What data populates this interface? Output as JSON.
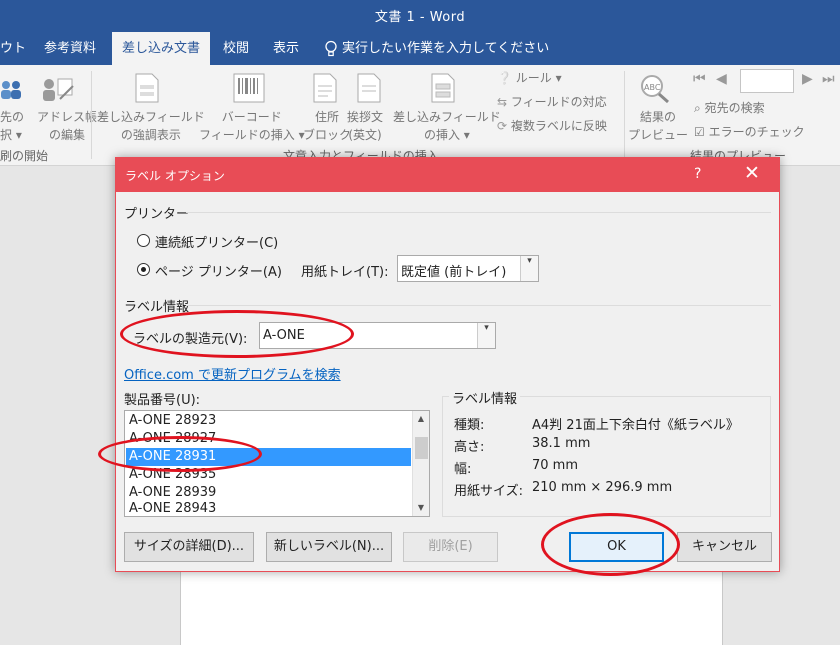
{
  "window": {
    "title": "文書 1  -  Word"
  },
  "menu_tabs": {
    "layout_partial": "ウト",
    "references": "参考資料",
    "mailings": "差し込み文書",
    "review": "校閲",
    "view": "表示",
    "tell_me": "実行したい作業を入力してください"
  },
  "ribbon": {
    "select_recipients_1": "先の",
    "select_recipients_2": "択 ▾",
    "edit_recipients_1": "アドレス帳",
    "edit_recipients_2": "の編集",
    "group_start": "刷の開始",
    "highlight_1": "差し込みフィールド",
    "highlight_2": "の強調表示",
    "barcode_1": "バーコード",
    "barcode_2": "フィールドの挿入 ▾",
    "address_1": "住所",
    "address_2": "ブロック",
    "greeting_1": "挨拶文",
    "greeting_2": "(英文)",
    "insert_merge_1": "差し込みフィールド",
    "insert_merge_2": "の挿入 ▾",
    "rules": "ルール ▾",
    "match_fields": "フィールドの対応",
    "update_labels": "複数ラベルに反映",
    "group_write": "文章入力とフィールドの挿入",
    "preview_1": "結果の",
    "preview_2": "プレビュー",
    "find_recipient": "宛先の検索",
    "check_errors": "エラーのチェック",
    "group_preview": "結果のプレビュー"
  },
  "dialog": {
    "title": "ラベル オプション",
    "help": "?",
    "close": "✕",
    "printer_group": "プリンター",
    "continuous_printer": "連続紙プリンター(C)",
    "page_printer": "ページ プリンター(A)",
    "paper_tray_label": "用紙トレイ(T):",
    "paper_tray_value": "既定値 (前トレイ)",
    "label_info_group": "ラベル情報",
    "vendor_label": "ラベルの製造元(V):",
    "vendor_value": "A-ONE",
    "update_link": "Office.com で更新プログラムを検索",
    "product_number_label": "製品番号(U):",
    "products": [
      "A-ONE 28923",
      "A-ONE 28927",
      "A-ONE 28931",
      "A-ONE 28935",
      "A-ONE 28939",
      "A-ONE 28943"
    ],
    "selected_product": "A-ONE 28931",
    "info": {
      "caption": "ラベル情報",
      "type_label": "種類:",
      "type_value": "A4判 21面上下余白付《紙ラベル》",
      "height_label": "高さ:",
      "height_value": "38.1 mm",
      "width_label": "幅:",
      "width_value": "70 mm",
      "paper_label": "用紙サイズ:",
      "paper_value": "210 mm × 296.9 mm"
    },
    "buttons": {
      "details": "サイズの詳細(D)...",
      "new_label": "新しいラベル(N)...",
      "delete": "削除(E)",
      "ok": "OK",
      "cancel": "キャンセル"
    }
  },
  "colors": {
    "word_blue": "#2b579a",
    "dialog_title": "#e84c56",
    "selection": "#3399ff",
    "annotation": "#e0131f",
    "link": "#0563c1"
  }
}
